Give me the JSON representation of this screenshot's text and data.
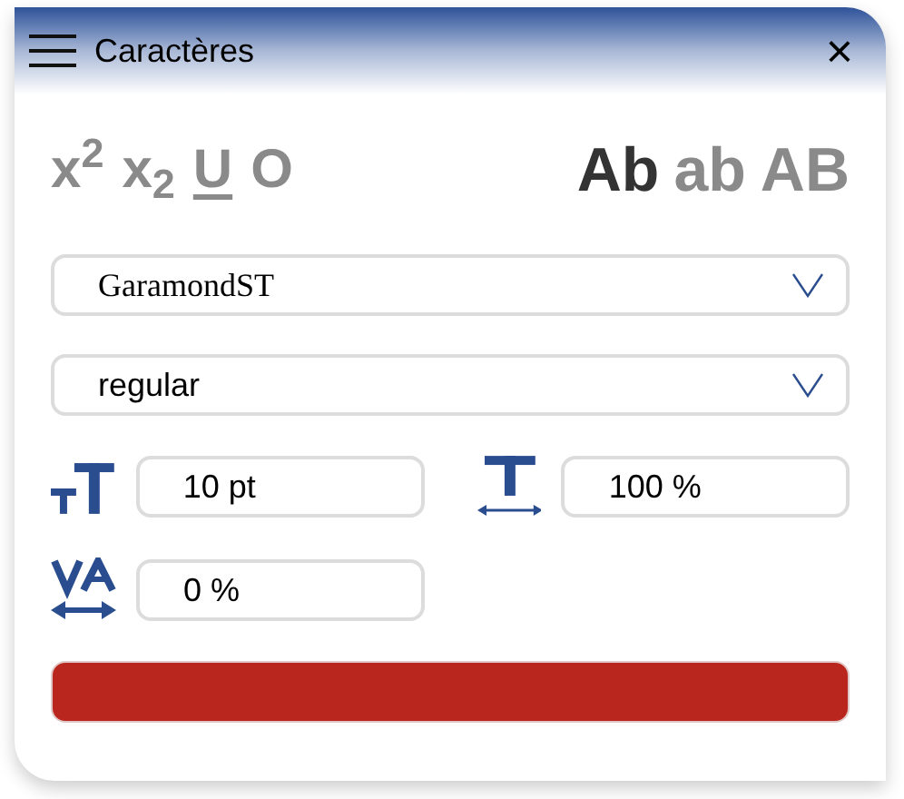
{
  "window": {
    "title": "Caractères",
    "close": "×"
  },
  "style_buttons": [
    {
      "label": "x$^{2}$",
      "selected": false
    },
    {
      "label": "x$_{2}$",
      "selected": false
    },
    {
      "label": "U",
      "kind": "underline",
      "selected": false
    },
    {
      "label": "O",
      "kind": "outline",
      "selected": false
    }
  ],
  "case_buttons": [
    {
      "label": "Ab",
      "selected": true
    },
    {
      "label": "ab",
      "selected": false
    },
    {
      "label": "AB",
      "selected": false
    }
  ],
  "font_family": {
    "value": "GaramondST"
  },
  "font_style": {
    "value": "regular"
  },
  "size": {
    "value": "10 pt"
  },
  "scale": {
    "value": "100 %"
  },
  "tracking": {
    "value": "0 %"
  },
  "color_swatch": {
    "color": "#b9261d"
  }
}
